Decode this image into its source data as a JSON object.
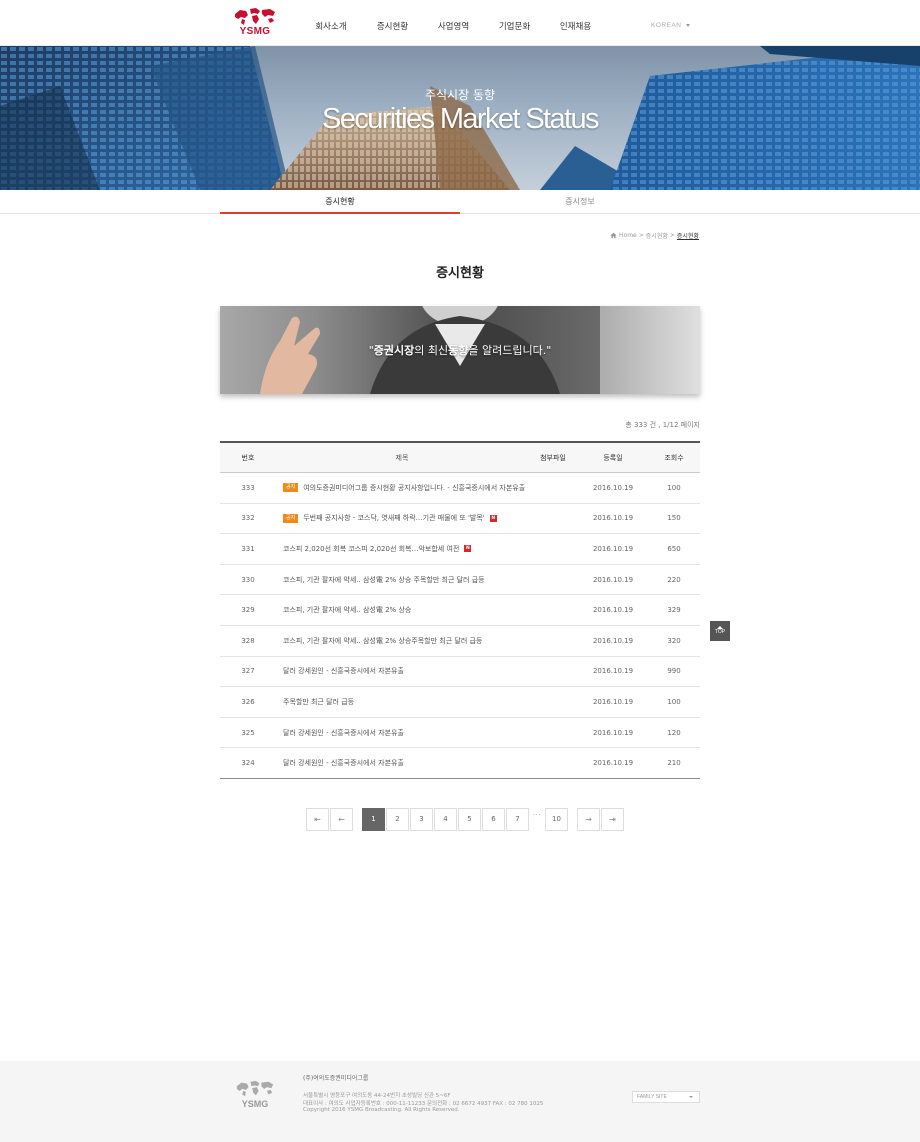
{
  "header": {
    "logo_text": "YSMG",
    "nav": [
      "회사소개",
      "증시현황",
      "사업영역",
      "기업문화",
      "인재채용"
    ],
    "language": "KOREAN"
  },
  "hero": {
    "subtitle": "주식시장 동향",
    "title": "Securities Market Status"
  },
  "subtabs": [
    {
      "label": "증시현황",
      "active": true
    },
    {
      "label": "증시정보",
      "active": false
    }
  ],
  "breadcrumb": {
    "home": "Home",
    "sep1": ">",
    "level1": "증시현황",
    "sep2": ">",
    "current": "증시현황"
  },
  "page_title": "증시현황",
  "banner": {
    "quote_open": "\"",
    "bold1": "증권시장",
    "text1": "의 최신",
    "bold2": "동향",
    "text2": "을 알려드립니다.\""
  },
  "count_text": "총 333 건 ,   1/12 페이지",
  "table": {
    "headers": {
      "no": "번호",
      "title": "제목",
      "file": "첨부파일",
      "date": "등록일",
      "views": "조회수"
    },
    "rows": [
      {
        "no": "333",
        "notice": "공지",
        "title": "여의도증권미디어그룹 증시현황 공지사항입니다. - 신흥국증시에서 자본유출",
        "new": "N",
        "date": "2016.10.19",
        "views": "100"
      },
      {
        "no": "332",
        "notice": "공지",
        "title": "두번째 공지사항 - 코스닥, 엿새째 하락…기관 매물에 또 '발목'",
        "new": "N",
        "date": "2016.10.19",
        "views": "150"
      },
      {
        "no": "331",
        "notice": "",
        "title": "코스피 2,020선 회복 코스피 2,020선 회복…악보합세 여전",
        "new": "N",
        "date": "2016.10.19",
        "views": "650"
      },
      {
        "no": "330",
        "notice": "",
        "title": "코스피, 기관 팔자에 약세.. 삼성電 2% 상승 주목할만 최근 달러 급등",
        "new": "",
        "date": "2016.10.19",
        "views": "220"
      },
      {
        "no": "329",
        "notice": "",
        "title": "코스피, 기관 팔자에 약세.. 삼성電 2% 상승",
        "new": "",
        "date": "2016.10.19",
        "views": "329"
      },
      {
        "no": "328",
        "notice": "",
        "title": "코스피, 기관 팔자에 약세.. 삼성電 2% 상승주목할만 최근 달러 급등",
        "new": "",
        "date": "2016.10.19",
        "views": "320"
      },
      {
        "no": "327",
        "notice": "",
        "title": "달러 강세원인 - 신흥국증시에서 자본유출",
        "new": "",
        "date": "2016.10.19",
        "views": "990"
      },
      {
        "no": "326",
        "notice": "",
        "title": "주목할만 최근 달러 급등",
        "new": "",
        "date": "2016.10.19",
        "views": "100"
      },
      {
        "no": "325",
        "notice": "",
        "title": "달러 강세원인 - 신흥국증시에서 자본유출",
        "new": "",
        "date": "2016.10.19",
        "views": "120"
      },
      {
        "no": "324",
        "notice": "",
        "title": "달러 강세원인 - 신흥국증시에서 자본유출",
        "new": "",
        "date": "2016.10.19",
        "views": "210"
      }
    ]
  },
  "top_button": "TOP",
  "pagination": {
    "first": "⇤",
    "prev": "←",
    "pages": [
      "1",
      "2",
      "3",
      "4",
      "5",
      "6",
      "7"
    ],
    "active": "1",
    "dots": "···",
    "last_page": "10",
    "next": "→",
    "last": "⇥"
  },
  "footer": {
    "logo_text": "YSMG",
    "company": "(주)여의도증권미디어그룹",
    "address": "서울특별시 영등포구 여의도동 44-24번지 초성빌딩 신관 5~6F",
    "info": "대표이사 : 여의도    사업자등록번호 : 000-11-11233    문의전화 : 02 6672 4937    FAX : 02 780 1025",
    "copyright": "Copyright 2016 YSMG Broadcasting. All Rights Reserved.",
    "family_site": "FAMILY SITE"
  },
  "colors": {
    "accent": "#e23b2b",
    "notice": "#f08a1d",
    "new": "#d42a2a",
    "logo": "#c8102e"
  }
}
